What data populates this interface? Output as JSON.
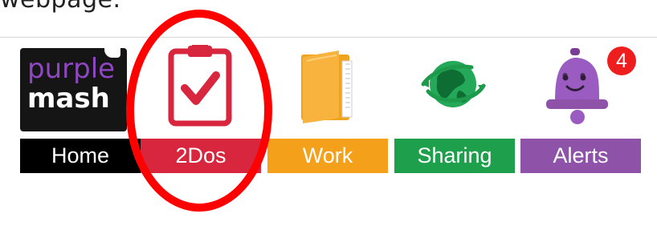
{
  "caption": {
    "text": "webpage."
  },
  "nav": {
    "items": [
      {
        "label": "Home",
        "icon": "purple-mash-logo",
        "color": "#000000",
        "logo_line1": "purple",
        "logo_line2": "mash"
      },
      {
        "label": "2Dos",
        "icon": "clipboard-check-icon",
        "color": "#d7263d"
      },
      {
        "label": "Work",
        "icon": "folder-icon",
        "color": "#f5a01a"
      },
      {
        "label": "Sharing",
        "icon": "globe-icon",
        "color": "#1e9f4b"
      },
      {
        "label": "Alerts",
        "icon": "bell-icon",
        "color": "#8e53a8",
        "badge": "4"
      }
    ]
  },
  "annotation": {
    "target": "2Dos",
    "shape": "red-oval",
    "color": "#ff0000"
  }
}
